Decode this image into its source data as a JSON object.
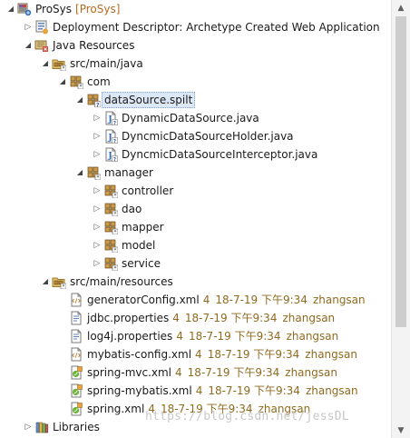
{
  "tree": {
    "project": {
      "label": "ProSys",
      "deco": "[ProSys]"
    },
    "deployment": {
      "label": "Deployment Descriptor: Archetype Created Web Application"
    },
    "java_resources": {
      "label": "Java Resources"
    },
    "src_main_java": {
      "label": "src/main/java"
    },
    "com": {
      "label": "com"
    },
    "datasource_pkg": {
      "label": "dataSource.spilt"
    },
    "java_files": [
      {
        "label": "DynamicDataSource.java"
      },
      {
        "label": "DyncmicDataSourceHolder.java"
      },
      {
        "label": "DyncmicDataSourceInterceptor.java"
      }
    ],
    "manager": {
      "label": "manager"
    },
    "manager_children": [
      {
        "label": "controller"
      },
      {
        "label": "dao"
      },
      {
        "label": "mapper"
      },
      {
        "label": "model"
      },
      {
        "label": "service"
      }
    ],
    "src_main_resources": {
      "label": "src/main/resources"
    },
    "resource_files": [
      {
        "label": "generatorConfig.xml",
        "rev": "4",
        "date": "18-7-19 下午9:34",
        "user": "zhangsan"
      },
      {
        "label": "jdbc.properties",
        "rev": "4",
        "date": "18-7-19 下午9:34",
        "user": "zhangsan"
      },
      {
        "label": "log4j.properties",
        "rev": "4",
        "date": "18-7-19 下午9:34",
        "user": "zhangsan"
      },
      {
        "label": "mybatis-config.xml",
        "rev": "4",
        "date": "18-7-19 下午9:34",
        "user": "zhangsan"
      },
      {
        "label": "spring-mvc.xml",
        "rev": "4",
        "date": "18-7-19 下午9:34",
        "user": "zhangsan"
      },
      {
        "label": "spring-mybatis.xml",
        "rev": "4",
        "date": "18-7-19 下午9:34",
        "user": "zhangsan"
      },
      {
        "label": "spring.xml",
        "rev": "4",
        "date": "18-7-19 下午9:34",
        "user": "zhangsan"
      }
    ],
    "libraries": {
      "label": "Libraries"
    }
  },
  "watermark": "https://blog.csdn.net/jessDL",
  "icons": {
    "project": "web-project-icon",
    "deployment": "deployment-descriptor-icon",
    "java_resources": "java-resources-icon",
    "source_folder": "source-folder-icon",
    "package": "package-icon",
    "java_file": "java-file-icon",
    "xml_file": "xml-file-icon",
    "properties_file": "properties-file-icon",
    "spring_file": "spring-file-icon",
    "libraries": "libraries-icon"
  },
  "colors": {
    "selection_bg": "#dde8f6",
    "svn_decoration": "#8f6a1f",
    "package_brown": "#b5823b",
    "watermark": "#c8c8c8"
  }
}
